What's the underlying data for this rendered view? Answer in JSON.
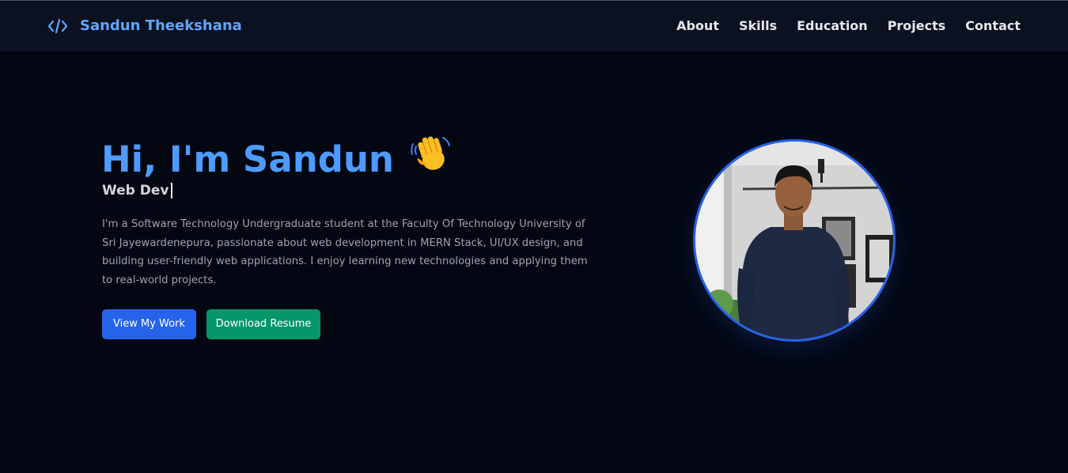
{
  "header": {
    "logo_icon": "code-icon",
    "brand_name": "Sandun Theekshana",
    "nav": [
      "About",
      "Skills",
      "Education",
      "Projects",
      "Contact"
    ]
  },
  "hero": {
    "title": "Hi, I'm Sandun",
    "title_emoji_icon": "waving-hand-icon",
    "role_text": "Web Dev",
    "bio": "I'm a Software Technology Undergraduate student at the Faculty Of Technology University of Sri Jayewardenepura, passionate about web development in MERN Stack, UI/UX design, and building user-friendly web applications. I enjoy learning new technologies and applying them to real-world projects.",
    "buttons": {
      "view_work": "View My Work",
      "download_resume": "Download Resume"
    }
  },
  "colors": {
    "background": "#030712",
    "header": "#0b1120",
    "accent": "#4d9bff",
    "primary_button": "#2563eb",
    "secondary_button": "#059669"
  }
}
